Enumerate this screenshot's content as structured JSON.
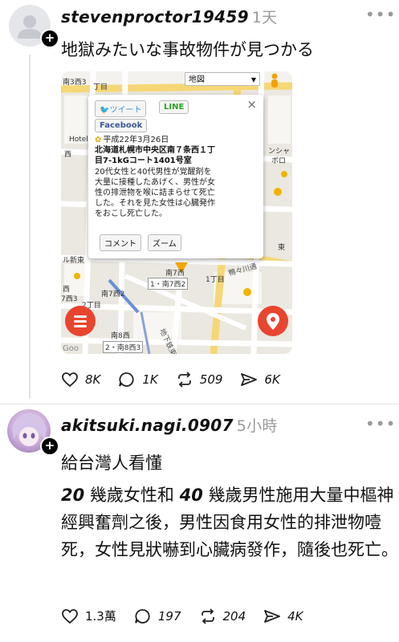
{
  "post1": {
    "username": "stevenproctor19459",
    "time": "1天",
    "text": "地獄みたいな事故物件が見つかる",
    "likes": "8K",
    "comments": "1K",
    "reposts": "509",
    "shares": "6K"
  },
  "map": {
    "tweet_label": "ツイート",
    "line_label": "LINE",
    "facebook_label": "Facebook",
    "date": "平成22年3月26日",
    "address_line1": "北海道札幌市中央区南７条西１丁",
    "address_line2": "目7-1kGコート1401号室",
    "desc_lines": [
      "20代女性と40代男性が覚醒剤を",
      "大量に接種したあげく、男性が女",
      "性の排泄物を喉に詰まらせて死亡",
      "した。それを見た女性は心臓発作",
      "をおこし死亡した。"
    ],
    "comment_button": "コメント",
    "zoom_button": "ズーム",
    "close_glyph": "×",
    "dropdown_label": "地図",
    "labels": {
      "l1": "南3西3",
      "l2": "丁目",
      "l3": "Hotel",
      "l4": "西",
      "l5": "ンシャ",
      "l6": "ボロ",
      "l7": "ル新東",
      "l8": "南7西",
      "l9": "1・南7西2",
      "l10": "1丁目",
      "l11": "西",
      "l12": "7西3",
      "l13": "2丁目",
      "l14": "南7西2",
      "l15": "南8西",
      "l16": "2・南8西3",
      "l17": "地下鉄東豊線",
      "l18": "鴨々川通",
      "l19": "東",
      "l20": "Goo"
    }
  },
  "post2": {
    "username": "akitsuki.nagi.0907",
    "time": "5小時",
    "text1": "給台灣人看懂",
    "num1": "20",
    "seg1": " 幾歲女性和 ",
    "num2": "40",
    "seg2": " 幾歲男性施用大量中樞神經興奮劑之後，男性因食用女性的排泄物噎死，女性見狀嚇到心臟病發作，隨後也死亡。",
    "likes": "1.3萬",
    "comments": "197",
    "reposts": "204",
    "shares": "4K"
  },
  "menu_glyph": "•••",
  "plus_glyph": "+"
}
